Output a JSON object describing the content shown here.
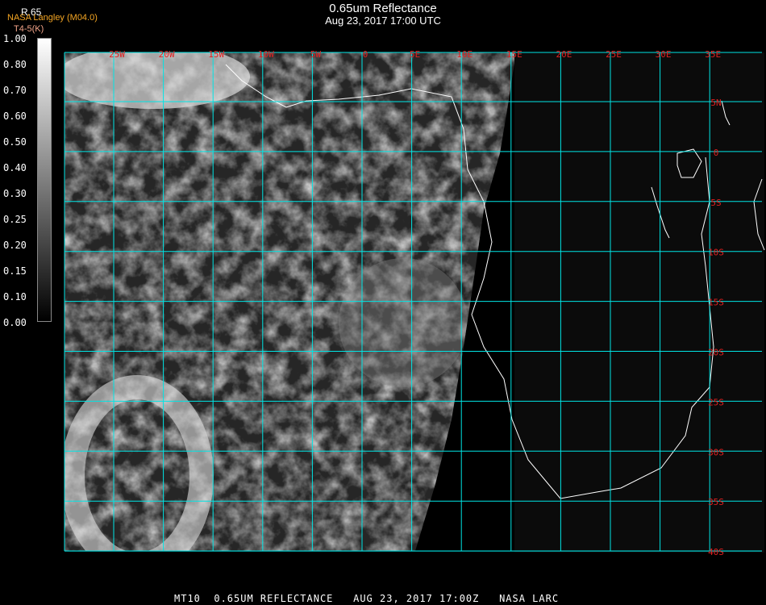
{
  "header": {
    "title": "0.65um Reflectance",
    "subtitle": "Aug 23, 2017 17:00 UTC",
    "organization": "NASA Langley (M04.0)",
    "product_label": "R.65",
    "secondary_unit": "T4-5(K)"
  },
  "colorbar": {
    "labels": [
      "1.00",
      "0.80",
      "0.70",
      "0.60",
      "0.50",
      "0.40",
      "0.30",
      "0.25",
      "0.20",
      "0.15",
      "0.10",
      "0.00"
    ]
  },
  "map": {
    "longitude_labels": [
      "25W",
      "20W",
      "15W",
      "10W",
      "5W",
      "0",
      "5E",
      "10E",
      "15E",
      "20E",
      "25E",
      "30E",
      "35E"
    ],
    "latitude_labels": [
      "5N",
      "0",
      "5S",
      "10S",
      "15S",
      "20S",
      "25S",
      "30S",
      "35S",
      "40S"
    ],
    "grid_color": "#00e5e5",
    "label_color": "#e02020",
    "coastline_color": "#ffffff"
  },
  "footer": {
    "satellite": "MT10",
    "product": "0.65UM REFLECTANCE",
    "datetime": "AUG 23, 2017 17:00Z",
    "source": "NASA LARC"
  }
}
